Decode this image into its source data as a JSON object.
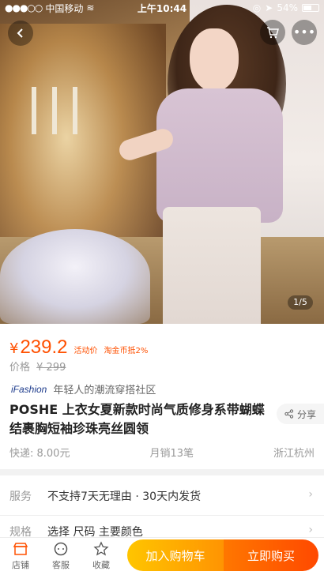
{
  "status_bar": {
    "carrier": "中国移动",
    "time": "上午10:44",
    "battery": "54%"
  },
  "gallery": {
    "counter": "1/5"
  },
  "price": {
    "symbol": "¥",
    "value": "239.2",
    "tag_activity": "活动价",
    "tag_coin": "淘金币抵2%"
  },
  "original_price": {
    "label": "价格",
    "value": "¥ 299"
  },
  "brand": {
    "logo": "iFashion",
    "slogan": "年轻人的潮流穿搭社区"
  },
  "product": {
    "title": "POSHE 上衣女夏新款时尚气质修身系带蝴蝶结裹胸短袖珍珠亮丝圆领",
    "share_label": "分享"
  },
  "meta": {
    "shipping": "快递: 8.00元",
    "sales": "月销13笔",
    "location": "浙江杭州"
  },
  "service": {
    "label": "服务",
    "value": "不支持7天无理由 · 30天内发货"
  },
  "spec": {
    "label": "规格",
    "value": "选择 尺码 主要颜色"
  },
  "bottom_bar": {
    "store": "店铺",
    "support": "客服",
    "favorite": "收藏",
    "add_to_cart": "加入购物车",
    "buy_now": "立即购买"
  },
  "colors": {
    "accent": "#ff5000",
    "cart_btn": "#ffa200",
    "buy_btn": "#ff5a00"
  }
}
